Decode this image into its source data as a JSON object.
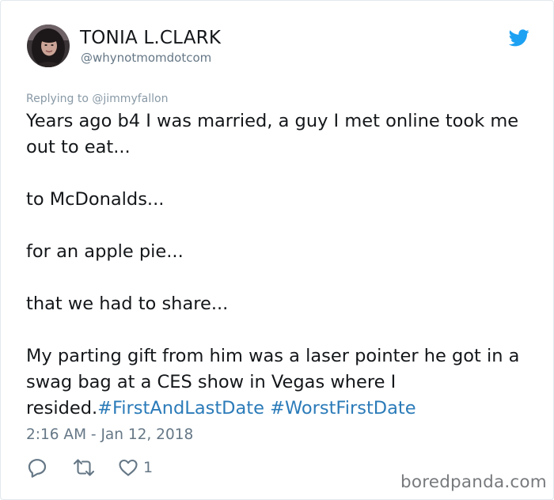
{
  "author": {
    "name": "TONIA L.CLARK",
    "handle": "@whynotmomdotcom",
    "avatar_icon": "user-avatar-photo"
  },
  "platform_icon": "twitter-bird-icon",
  "replying": {
    "prefix": "Replying to ",
    "mention": "@jimmyfallon"
  },
  "tweet": {
    "paragraphs": [
      "Years ago b4 I was married, a guy I met online took me out to eat...",
      "to McDonalds...",
      "for an apple pie...",
      "that we had to share...",
      "My parting gift from him was a laser pointer he got in a swag bag at a CES show in Vegas where I resided."
    ],
    "hashtags": [
      "#FirstAndLastDate",
      "#WorstFirstDate"
    ]
  },
  "timestamp": "2:16 AM - Jan 12, 2018",
  "actions": {
    "reply_icon": "reply-icon",
    "retweet_icon": "retweet-icon",
    "like_icon": "heart-icon",
    "like_count": "1"
  },
  "watermark": "boredpanda.com",
  "colors": {
    "hashtag": "#2b7bb9",
    "twitter_blue": "#1da1f2",
    "secondary_text": "#657786",
    "primary_text": "#14171a"
  }
}
